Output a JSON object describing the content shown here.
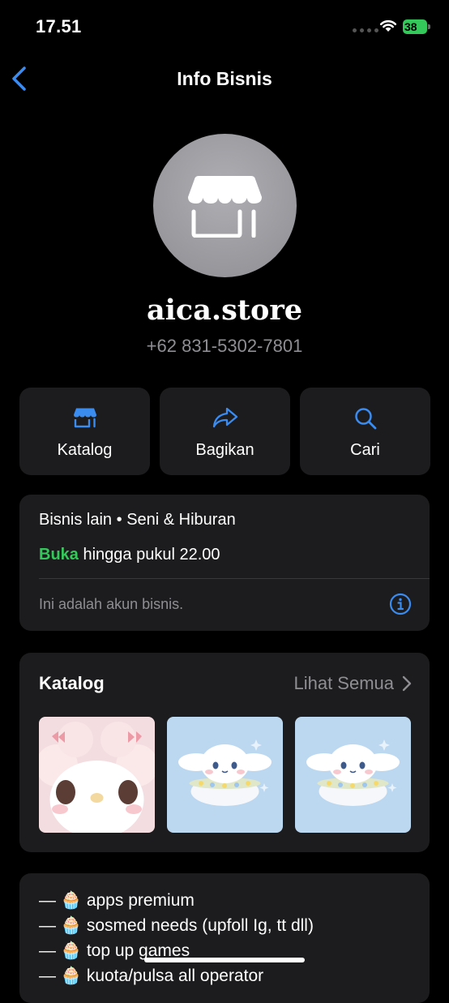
{
  "status_bar": {
    "time": "17.51",
    "battery": "38",
    "battery_color": "#34c759"
  },
  "nav": {
    "title": "Info Bisnis",
    "back_icon": "chevron-left-icon"
  },
  "profile": {
    "avatar_icon": "storefront-icon",
    "name": "aica.store",
    "phone": "+62 831-5302-7801"
  },
  "actions": [
    {
      "label": "Katalog",
      "icon": "storefront-icon"
    },
    {
      "label": "Bagikan",
      "icon": "share-arrow-icon"
    },
    {
      "label": "Cari",
      "icon": "search-icon"
    }
  ],
  "info": {
    "category": "Bisnis lain",
    "separator": "•",
    "subcategory": "Seni & Hiburan",
    "open_status": "Buka",
    "open_color": "#34c759",
    "hours": "hingga pukul 22.00",
    "notice": "Ini adalah akun bisnis.",
    "info_icon": "info-circle-icon"
  },
  "catalog": {
    "title": "Katalog",
    "see_all": "Lihat Semua",
    "items": [
      {
        "icon": "character-thumbnail",
        "bg": "#f3dde0"
      },
      {
        "icon": "cinnamoroll-thumbnail",
        "bg": "#bcd8f0"
      },
      {
        "icon": "cinnamoroll-thumbnail",
        "bg": "#bcd8f0"
      }
    ]
  },
  "description": {
    "lines": [
      "— 🧁 apps premium",
      "— 🧁 sosmed needs (upfoll Ig, tt dll)",
      "— 🧁 top up games",
      "— 🧁 kuota/pulsa all operator"
    ]
  },
  "accent_color": "#3b8cf0"
}
